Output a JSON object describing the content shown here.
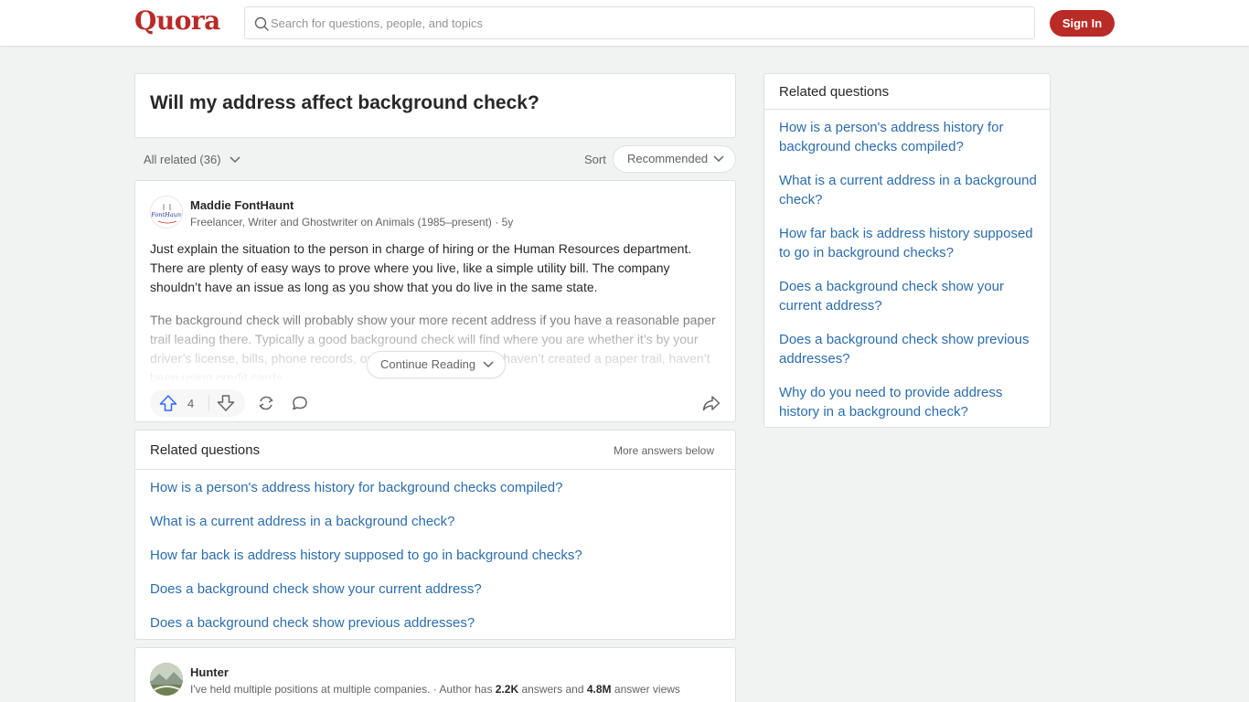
{
  "header": {
    "logo": "Quora",
    "search_placeholder": "Search for questions, people, and topics",
    "signin_label": "Sign In"
  },
  "question": {
    "title": "Will my address affect background check?"
  },
  "filters": {
    "all_related": "All related (36)",
    "sort_label": "Sort",
    "sort_value": "Recommended"
  },
  "answer": {
    "author": "Maddie FontHaunt",
    "avatar_text": "FontHaunt",
    "credential": "Freelancer, Writer and Ghostwriter on Animals (1985–present) · 5y",
    "paragraph1": "Just explain the situation to the person in charge of hiring or the Human Resources department. There are plenty of easy ways to prove where you live, like a simple utility bill. The company shouldn’t have an issue as long as you show that you do live in the same state.",
    "paragraph2": "The background check will probably show your more recent address if you have a reasonable paper trail leading there. Typically a good background check will find where you are whether it’s by your driver’s license, bills, phone records, or something else. If you haven’t created a paper trail, haven’t been using credit cards,",
    "continue_label": "Continue Reading",
    "upvotes": "4"
  },
  "related_inline": {
    "title": "Related questions",
    "more_label": "More answers below",
    "items": [
      "How is a person's address history for background checks compiled?",
      "What is a current address in a background check?",
      "How far back is address history supposed to go in background checks?",
      "Does a background check show your current address?",
      "Does a background check show previous addresses?"
    ]
  },
  "answer2": {
    "author": "Hunter",
    "credential_prefix": "I've held multiple positions at multiple companies. · Author has ",
    "answers_count": "2.2K",
    "credential_mid": " answers and ",
    "views_count": "4.8M",
    "credential_suffix": " answer views"
  },
  "sidebar": {
    "title": "Related questions",
    "items": [
      "How is a person's address history for background checks compiled?",
      "What is a current address in a background check?",
      "How far back is address history supposed to go in background checks?",
      "Does a background check show your current address?",
      "Does a background check show previous addresses?",
      "Why do you need to provide address history in a background check?"
    ]
  },
  "colors": {
    "brand": "#b92b27",
    "link": "#2b6dad",
    "upvote": "#2e69ff"
  }
}
